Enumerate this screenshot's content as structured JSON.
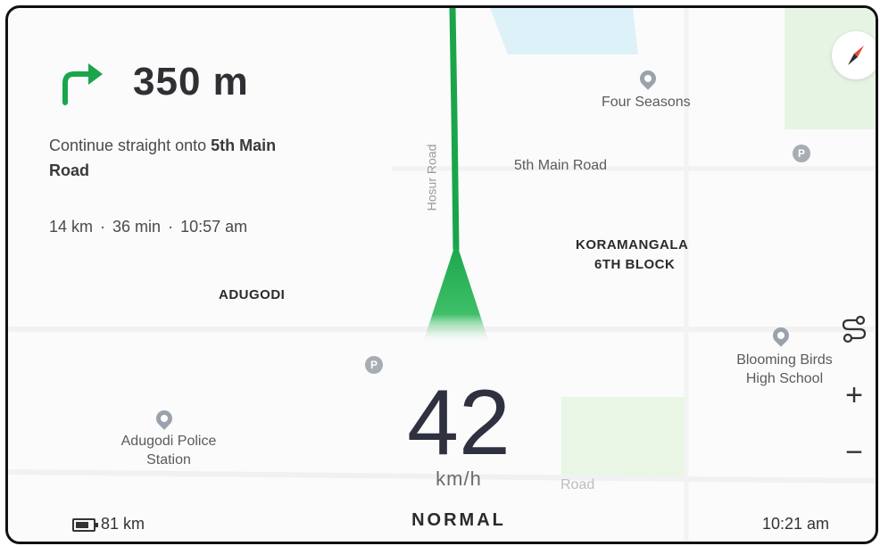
{
  "navigation": {
    "distance": "350 m",
    "instruction_prefix": "Continue straight onto ",
    "instruction_street": "5th Main Road",
    "trip": {
      "remaining_distance": "14 km",
      "duration": "36 min",
      "arrival": "10:57 am",
      "separator": "·"
    }
  },
  "map": {
    "labels": {
      "four_seasons": "Four Seasons",
      "fifth_main_road": "5th Main Road",
      "hosur_road": "Hosur Road",
      "koramangala_line1": "KORAMANGALA",
      "koramangala_line2": "6TH BLOCK",
      "adugodi": "ADUGODI",
      "blooming_birds_line1": "Blooming Birds",
      "blooming_birds_line2": "High School",
      "adugodi_police_line1": "Adugodi Police",
      "adugodi_police_line2": "Station",
      "road": "Road"
    },
    "parking_letter": "P",
    "colors": {
      "route": "#1aa54a",
      "park": "#e3f3e1",
      "water": "#d9f1f8"
    }
  },
  "dashboard": {
    "speed": "42",
    "speed_unit": "km/h",
    "mode": "NORMAL",
    "battery_range": "81 km",
    "time": "10:21 am"
  },
  "controls": {
    "zoom_in": "+",
    "zoom_out": "−"
  },
  "icons": {
    "turn": "turn-right-arrow-icon",
    "compass": "compass-icon",
    "route_options": "route-options-icon",
    "battery": "battery-icon"
  }
}
